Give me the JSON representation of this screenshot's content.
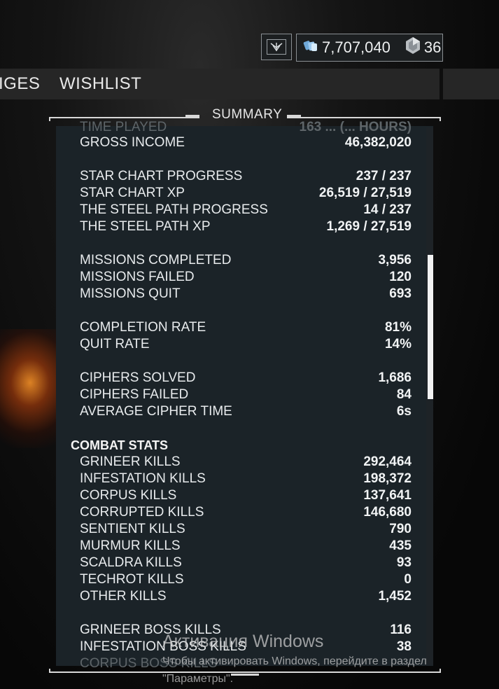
{
  "header": {
    "credits": "7,707,040",
    "platinum": "36",
    "credits_icon": "credits-icon",
    "platinum_icon": "platinum-icon"
  },
  "tabs": [
    {
      "label": "IGES"
    },
    {
      "label": "WISHLIST"
    }
  ],
  "summary": {
    "title": "SUMMARY",
    "top_cut_row": {
      "label": "TIME PLAYED",
      "value": "163 ... (... HOURS)"
    },
    "groups": [
      [
        {
          "label": "GROSS INCOME",
          "value": "46,382,020"
        }
      ],
      [
        {
          "label": "STAR CHART PROGRESS",
          "value": "237 / 237"
        },
        {
          "label": "STAR CHART XP",
          "value": "26,519 / 27,519"
        },
        {
          "label": "THE STEEL PATH PROGRESS",
          "value": "14 / 237"
        },
        {
          "label": "THE STEEL PATH XP",
          "value": "1,269 / 27,519"
        }
      ],
      [
        {
          "label": "MISSIONS COMPLETED",
          "value": "3,956"
        },
        {
          "label": "MISSIONS FAILED",
          "value": "120"
        },
        {
          "label": "MISSIONS QUIT",
          "value": "693"
        }
      ],
      [
        {
          "label": "COMPLETION RATE",
          "value": "81%"
        },
        {
          "label": "QUIT RATE",
          "value": "14%"
        }
      ],
      [
        {
          "label": "CIPHERS SOLVED",
          "value": "1,686"
        },
        {
          "label": "CIPHERS FAILED",
          "value": "84"
        },
        {
          "label": "AVERAGE CIPHER TIME",
          "value": "6s"
        }
      ]
    ],
    "combat_title": "COMBAT STATS",
    "combat": [
      {
        "label": "GRINEER KILLS",
        "value": "292,464"
      },
      {
        "label": "INFESTATION KILLS",
        "value": "198,372"
      },
      {
        "label": "CORPUS KILLS",
        "value": "137,641"
      },
      {
        "label": "CORRUPTED KILLS",
        "value": "146,680"
      },
      {
        "label": "SENTIENT KILLS",
        "value": "790"
      },
      {
        "label": "MURMUR KILLS",
        "value": "435"
      },
      {
        "label": "SCALDRA KILLS",
        "value": "93"
      },
      {
        "label": "TECHROT KILLS",
        "value": "0"
      },
      {
        "label": "OTHER KILLS",
        "value": "1,452"
      }
    ],
    "boss": [
      {
        "label": "GRINEER BOSS KILLS",
        "value": "116"
      },
      {
        "label": "INFESTATION BOSS KILLS",
        "value": "38"
      }
    ],
    "bottom_cut_row": {
      "label": "CORPUS BOSS KILLS",
      "value": ""
    }
  },
  "watermark": {
    "title": "Активация Windows",
    "line1": "Чтобы активировать Windows, перейдите в раздел",
    "line2": "\"Параметры\"."
  }
}
